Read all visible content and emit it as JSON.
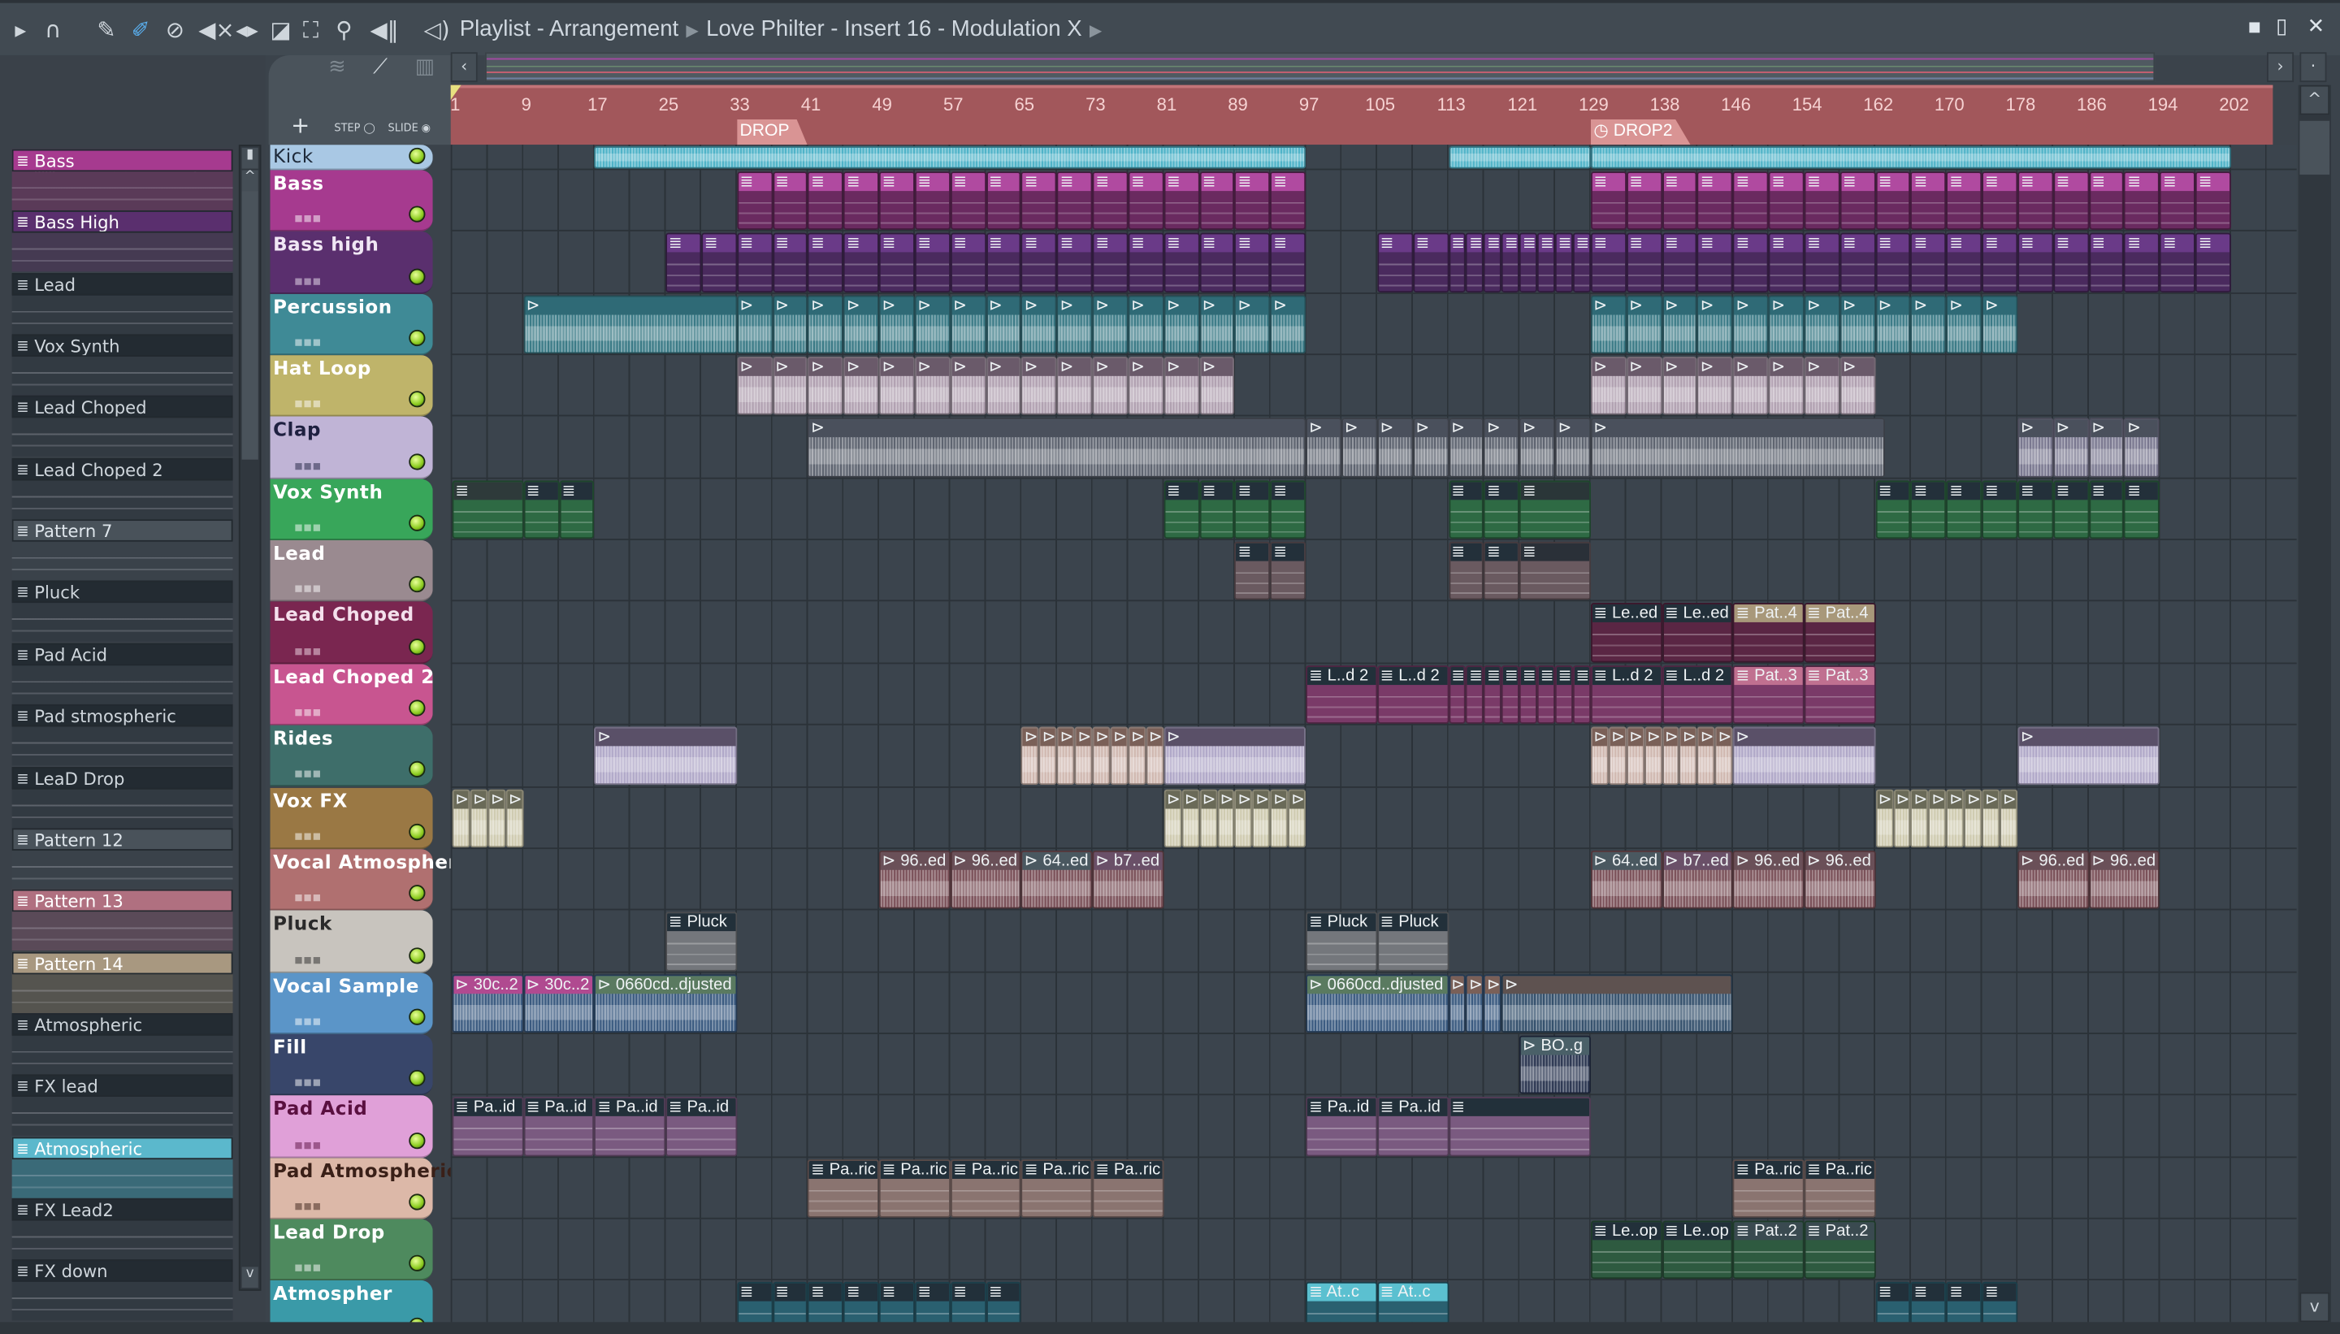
{
  "titlebar": {
    "crumbs": [
      "Playlist - Arrangement",
      "Love Philter - Insert 16 - Modulation X"
    ],
    "icons": [
      "play-arrow-icon",
      "magnet-icon",
      "pencil-icon",
      "paint-brush-icon",
      "mute-icon",
      "speaker-mute-icon",
      "slip-icon",
      "slice-icon",
      "select-icon",
      "zoom-icon",
      "playback-icon"
    ],
    "window_buttons": [
      "minimize",
      "maximize",
      "close"
    ]
  },
  "toolbar": {
    "add_label": "+",
    "step_label": "STEP",
    "slide_label": "SLIDE"
  },
  "picker": {
    "items": [
      {
        "name": "Bass",
        "color": "#a63a8f",
        "text": "#ffffff",
        "body": "#5a3a58"
      },
      {
        "name": "Bass High",
        "color": "#5a2f6e",
        "text": "#ffffff",
        "body": "#453a52"
      },
      {
        "name": "Lead",
        "color": "#232b32",
        "text": "#cfd6dc",
        "body": "#323a42"
      },
      {
        "name": "Vox Synth",
        "color": "#232b32",
        "text": "#cfd6dc",
        "body": "#323a42"
      },
      {
        "name": "Lead Choped",
        "color": "#232b32",
        "text": "#cfd6dc",
        "body": "#323a42"
      },
      {
        "name": "Lead Choped 2",
        "color": "#232b32",
        "text": "#cfd6dc",
        "body": "#323a42"
      },
      {
        "name": "Pattern 7",
        "color": "#49525a",
        "text": "#dfe6ec",
        "body": "#3a424a"
      },
      {
        "name": "Pluck",
        "color": "#232b32",
        "text": "#cfd6dc",
        "body": "#323a42"
      },
      {
        "name": "Pad Acid",
        "color": "#232b32",
        "text": "#cfd6dc",
        "body": "#323a42"
      },
      {
        "name": "Pad stmospheric",
        "color": "#232b32",
        "text": "#cfd6dc",
        "body": "#323a42"
      },
      {
        "name": "LeaD Drop",
        "color": "#232b32",
        "text": "#cfd6dc",
        "body": "#323a42"
      },
      {
        "name": "Pattern 12",
        "color": "#49525a",
        "text": "#dfe6ec",
        "body": "#3a424a"
      },
      {
        "name": "Pattern 13",
        "color": "#b07080",
        "text": "#ffffff",
        "body": "#5a4a58"
      },
      {
        "name": "Pattern 14",
        "color": "#a89880",
        "text": "#ffffff",
        "body": "#55544f"
      },
      {
        "name": "Atmospheric",
        "color": "#232b32",
        "text": "#cfd6dc",
        "body": "#323a42"
      },
      {
        "name": "FX lead",
        "color": "#232b32",
        "text": "#cfd6dc",
        "body": "#323a42"
      },
      {
        "name": "Atmospheric",
        "color": "#5bb8cc",
        "text": "#ffffff",
        "body": "#3a6a78"
      },
      {
        "name": "FX Lead2",
        "color": "#232b32",
        "text": "#cfd6dc",
        "body": "#323a42"
      },
      {
        "name": "FX down",
        "color": "#232b32",
        "text": "#cfd6dc",
        "body": "#323a42"
      }
    ]
  },
  "ruler": {
    "ticks": [
      "1",
      "9",
      "17",
      "25",
      "33",
      "41",
      "49",
      "57",
      "65",
      "73",
      "81",
      "89",
      "97",
      "105",
      "113",
      "121",
      "129",
      "138",
      "146",
      "154",
      "162",
      "170",
      "178",
      "186",
      "194",
      "202"
    ],
    "markers": [
      {
        "label": "DROP",
        "bar": 33,
        "icon": ""
      },
      {
        "label": "DROP2",
        "bar": 129,
        "icon": "clock-icon"
      }
    ]
  },
  "tracks": [
    {
      "name": "Kick",
      "color": "#a9c8e4",
      "text": "#1e2a3a"
    },
    {
      "name": "Bass",
      "color": "#a63a8f",
      "text": "#ffffff"
    },
    {
      "name": "Bass high",
      "color": "#5a2f6e",
      "text": "#f0e6f4"
    },
    {
      "name": "Percussion",
      "color": "#3f8a96",
      "text": "#ffffff"
    },
    {
      "name": "Hat Loop",
      "color": "#bfb46a",
      "text": "#ffffff"
    },
    {
      "name": "Clap",
      "color": "#c0b4d6",
      "text": "#1e2040"
    },
    {
      "name": "Vox Synth",
      "color": "#38a65a",
      "text": "#ffffff"
    },
    {
      "name": "Lead",
      "color": "#9a8a90",
      "text": "#ffffff"
    },
    {
      "name": "Lead Choped",
      "color": "#7a2650",
      "text": "#f4e0ec"
    },
    {
      "name": "Lead Choped 2",
      "color": "#c85590",
      "text": "#ffffff"
    },
    {
      "name": "Rides",
      "color": "#3e6e6a",
      "text": "#ffffff"
    },
    {
      "name": "Vox FX",
      "color": "#9a7844",
      "text": "#ffffff"
    },
    {
      "name": "Vocal Atmospheric",
      "color": "#b07070",
      "text": "#ffffff"
    },
    {
      "name": "Pluck",
      "color": "#c8c4be",
      "text": "#2a2a2a"
    },
    {
      "name": "Vocal Sample",
      "color": "#5b95c8",
      "text": "#ffffff"
    },
    {
      "name": "Fill",
      "color": "#38466a",
      "text": "#ffffff"
    },
    {
      "name": "Pad Acid",
      "color": "#e0a0d8",
      "text": "#5a1040"
    },
    {
      "name": "Pad Atmospheric",
      "color": "#dcb8a8",
      "text": "#3a2018"
    },
    {
      "name": "Lead Drop",
      "color": "#4e8a5e",
      "text": "#ffffff"
    },
    {
      "name": "Atmospher",
      "color": "#3a9aa8",
      "text": "#ffffff"
    }
  ],
  "clips": [
    {
      "t": 0,
      "s": 17,
      "n": 1,
      "l": 80,
      "type": "a",
      "label": "",
      "c": "#4fb3c8",
      "b": "#4fb3c8"
    },
    {
      "t": 0,
      "s": 113,
      "n": 1,
      "l": 16,
      "type": "a",
      "label": "",
      "c": "#4fb3c8",
      "b": "#4fb3c8"
    },
    {
      "t": 0,
      "s": 129,
      "n": 1,
      "l": 72,
      "type": "a",
      "label": "",
      "c": "#4fb3c8",
      "b": "#4fb3c8"
    },
    {
      "t": 1,
      "s": 33,
      "n": 16,
      "l": 4,
      "type": "p",
      "label": "",
      "c": "#b04aa0",
      "b": "#6a2a60"
    },
    {
      "t": 1,
      "s": 129,
      "n": 18,
      "l": 4,
      "type": "p",
      "label": "",
      "c": "#b04aa0",
      "b": "#6a2a60"
    },
    {
      "t": 2,
      "s": 25,
      "n": 18,
      "l": 4,
      "type": "p",
      "label": "",
      "c": "#6a3a88",
      "b": "#4a2a5e"
    },
    {
      "t": 2,
      "s": 105,
      "n": 2,
      "l": 4,
      "type": "p",
      "label": "",
      "c": "#6a3a88",
      "b": "#4a2a5e"
    },
    {
      "t": 2,
      "s": 113,
      "n": 8,
      "l": 2,
      "type": "p",
      "label": "",
      "c": "#6a3a88",
      "b": "#4a2a5e"
    },
    {
      "t": 2,
      "s": 129,
      "n": 18,
      "l": 4,
      "type": "p",
      "label": "",
      "c": "#6a3a88",
      "b": "#4a2a5e"
    },
    {
      "t": 3,
      "s": 9,
      "n": 1,
      "l": 24,
      "type": "a",
      "label": "",
      "c": "#2f6a76",
      "b": "#3a7a86"
    },
    {
      "t": 3,
      "s": 33,
      "n": 16,
      "l": 4,
      "type": "a",
      "label": "",
      "c": "#2f6a76",
      "b": "#3a7a86"
    },
    {
      "t": 3,
      "s": 129,
      "n": 12,
      "l": 4,
      "type": "a",
      "label": "",
      "c": "#2f6a76",
      "b": "#3a7a86"
    },
    {
      "t": 4,
      "s": 33,
      "n": 12,
      "l": 4,
      "type": "a",
      "label": "",
      "c": "#6a5a6a",
      "b": "#b0a0b0"
    },
    {
      "t": 4,
      "s": 81,
      "n": 2,
      "l": 4,
      "type": "a",
      "label": "",
      "c": "#6a5a6a",
      "b": "#b0a0b0"
    },
    {
      "t": 4,
      "s": 129,
      "n": 8,
      "l": 4,
      "type": "a",
      "label": "",
      "c": "#6a5a6a",
      "b": "#b0a0b0"
    },
    {
      "t": 5,
      "s": 41,
      "n": 1,
      "l": 56,
      "type": "a",
      "label": "",
      "c": "#4a505c",
      "b": "#5e6470"
    },
    {
      "t": 5,
      "s": 97,
      "n": 8,
      "l": 4,
      "type": "a",
      "label": "",
      "c": "#4a505c",
      "b": "#5e6470"
    },
    {
      "t": 5,
      "s": 129,
      "n": 1,
      "l": 33,
      "type": "a",
      "label": "",
      "c": "#4a505c",
      "b": "#5e6470"
    },
    {
      "t": 5,
      "s": 177,
      "n": 4,
      "l": 4,
      "type": "a",
      "label": "",
      "c": "#4a505c",
      "b": "#7a7890"
    },
    {
      "t": 6,
      "s": 1,
      "n": 1,
      "l": 8,
      "type": "p",
      "label": "",
      "c": "#2e3a3a",
      "b": "#2e6a44"
    },
    {
      "t": 6,
      "s": 9,
      "n": 2,
      "l": 4,
      "type": "p",
      "label": "",
      "c": "#23303a",
      "b": "#2e6a44"
    },
    {
      "t": 6,
      "s": 81,
      "n": 4,
      "l": 4,
      "type": "p",
      "label": "",
      "c": "#23303a",
      "b": "#2e6a44"
    },
    {
      "t": 6,
      "s": 113,
      "n": 2,
      "l": 4,
      "type": "p",
      "label": "",
      "c": "#23303a",
      "b": "#2e6a44"
    },
    {
      "t": 6,
      "s": 121,
      "n": 1,
      "l": 8,
      "type": "p",
      "label": "",
      "c": "#2a3638",
      "b": "#2e6a44"
    },
    {
      "t": 6,
      "s": 161,
      "n": 8,
      "l": 4,
      "type": "p",
      "label": "",
      "c": "#23303a",
      "b": "#2e6a44"
    },
    {
      "t": 7,
      "s": 89,
      "n": 2,
      "l": 4,
      "type": "p",
      "label": "",
      "c": "#23303a",
      "b": "#6a5a60"
    },
    {
      "t": 7,
      "s": 113,
      "n": 2,
      "l": 4,
      "type": "p",
      "label": "",
      "c": "#23303a",
      "b": "#6a5a60"
    },
    {
      "t": 7,
      "s": 121,
      "n": 1,
      "l": 8,
      "type": "p",
      "label": "",
      "c": "#2a3038",
      "b": "#6a5a60"
    },
    {
      "t": 8,
      "s": 129,
      "n": 2,
      "l": 8,
      "type": "p",
      "label": "Le..ed",
      "c": "#22303a",
      "b": "#5a2644"
    },
    {
      "t": 8,
      "s": 145,
      "n": 2,
      "l": 8,
      "type": "p",
      "label": "Pat..4",
      "c": "#a8987a",
      "b": "#5a2644"
    },
    {
      "t": 9,
      "s": 97,
      "n": 2,
      "l": 8,
      "type": "p",
      "label": "L..d 2",
      "c": "#22303a",
      "b": "#7a3a68"
    },
    {
      "t": 9,
      "s": 113,
      "n": 8,
      "l": 2,
      "type": "p",
      "label": "",
      "c": "#22303a",
      "b": "#7a3a68"
    },
    {
      "t": 9,
      "s": 129,
      "n": 2,
      "l": 8,
      "type": "p",
      "label": "L..d 2",
      "c": "#22303a",
      "b": "#7a3a68"
    },
    {
      "t": 9,
      "s": 145,
      "n": 2,
      "l": 8,
      "type": "p",
      "label": "Pat..3",
      "c": "#c07090",
      "b": "#7a3a68"
    },
    {
      "t": 10,
      "s": 17,
      "n": 1,
      "l": 16,
      "type": "a",
      "label": "",
      "c": "#5a5068",
      "b": "#b0a8c8"
    },
    {
      "t": 10,
      "s": 65,
      "n": 8,
      "l": 2,
      "type": "a",
      "label": "",
      "c": "#7a6058",
      "b": "#d0b8b0"
    },
    {
      "t": 10,
      "s": 81,
      "n": 1,
      "l": 16,
      "type": "a",
      "label": "",
      "c": "#5a5068",
      "b": "#b0a8c8"
    },
    {
      "t": 10,
      "s": 129,
      "n": 8,
      "l": 2,
      "type": "a",
      "label": "",
      "c": "#7a6058",
      "b": "#d0b8b0"
    },
    {
      "t": 10,
      "s": 145,
      "n": 1,
      "l": 16,
      "type": "a",
      "label": "",
      "c": "#5a5068",
      "b": "#b0a8c8"
    },
    {
      "t": 10,
      "s": 177,
      "n": 1,
      "l": 16,
      "type": "a",
      "label": "",
      "c": "#5a5068",
      "b": "#b0a8c8"
    },
    {
      "t": 11,
      "s": 1,
      "n": 4,
      "l": 2,
      "type": "a",
      "label": "",
      "c": "#6a6a58",
      "b": "#cfcbb0"
    },
    {
      "t": 11,
      "s": 81,
      "n": 8,
      "l": 2,
      "type": "a",
      "label": "",
      "c": "#6a6a58",
      "b": "#cfcbb0"
    },
    {
      "t": 11,
      "s": 161,
      "n": 8,
      "l": 2,
      "type": "a",
      "label": "",
      "c": "#6a6a58",
      "b": "#cfcbb0"
    },
    {
      "t": 12,
      "s": 49,
      "n": 2,
      "l": 8,
      "type": "a",
      "label": "96..ed",
      "c": "#6a5058",
      "b": "#7a5058"
    },
    {
      "t": 12,
      "s": 65,
      "n": 1,
      "l": 8,
      "type": "a",
      "label": "64..ed",
      "c": "#4a5860",
      "b": "#7a5058"
    },
    {
      "t": 12,
      "s": 73,
      "n": 1,
      "l": 8,
      "type": "a",
      "label": "b7..ed",
      "c": "#6a5068",
      "b": "#7a5058"
    },
    {
      "t": 12,
      "s": 129,
      "n": 1,
      "l": 8,
      "type": "a",
      "label": "64..ed",
      "c": "#4a5860",
      "b": "#7a5058"
    },
    {
      "t": 12,
      "s": 137,
      "n": 1,
      "l": 8,
      "type": "a",
      "label": "b7..ed",
      "c": "#6a5068",
      "b": "#7a5058"
    },
    {
      "t": 12,
      "s": 145,
      "n": 2,
      "l": 8,
      "type": "a",
      "label": "96..ed",
      "c": "#6a5058",
      "b": "#7a5058"
    },
    {
      "t": 12,
      "s": 177,
      "n": 2,
      "l": 8,
      "type": "a",
      "label": "96..ed",
      "c": "#6a5058",
      "b": "#7a5058"
    },
    {
      "t": 13,
      "s": 25,
      "n": 1,
      "l": 8,
      "type": "p",
      "label": "Pluck",
      "c": "#22303a",
      "b": "#74777c"
    },
    {
      "t": 13,
      "s": 97,
      "n": 2,
      "l": 8,
      "type": "p",
      "label": "Pluck",
      "c": "#22303a",
      "b": "#74777c"
    },
    {
      "t": 14,
      "s": 1,
      "n": 2,
      "l": 8,
      "type": "a",
      "label": "30c..2",
      "c": "#b04a90",
      "b": "#3a5a80"
    },
    {
      "t": 14,
      "s": 17,
      "n": 1,
      "l": 16,
      "type": "a",
      "label": "0660cd..djusted",
      "c": "#5a7a60",
      "b": "#3a5a80"
    },
    {
      "t": 14,
      "s": 97,
      "n": 1,
      "l": 16,
      "type": "a",
      "label": "0660cd..djusted",
      "c": "#5a7a60",
      "b": "#3a5a80"
    },
    {
      "t": 14,
      "s": 113,
      "n": 3,
      "l": 2,
      "type": "a",
      "label": "",
      "c": "#7a6058",
      "b": "#3a5a80"
    },
    {
      "t": 14,
      "s": 119,
      "n": 1,
      "l": 26,
      "type": "a",
      "label": "",
      "c": "#5e5250",
      "b": "#34506c"
    },
    {
      "t": 15,
      "s": 121,
      "n": 1,
      "l": 8,
      "type": "a",
      "label": "BO..g",
      "c": "#4a6068",
      "b": "#2a3550"
    },
    {
      "t": 16,
      "s": 1,
      "n": 4,
      "l": 8,
      "type": "p",
      "label": "Pa..id",
      "c": "#22303a",
      "b": "#7a5a80"
    },
    {
      "t": 16,
      "s": 97,
      "n": 2,
      "l": 8,
      "type": "p",
      "label": "Pa..id",
      "c": "#22303a",
      "b": "#7a5a80"
    },
    {
      "t": 16,
      "s": 113,
      "n": 1,
      "l": 16,
      "type": "p",
      "label": "",
      "c": "#22303a",
      "b": "#7a5a80"
    },
    {
      "t": 17,
      "s": 41,
      "n": 5,
      "l": 8,
      "type": "p",
      "label": "Pa..ric",
      "c": "#22303a",
      "b": "#8a7470"
    },
    {
      "t": 17,
      "s": 145,
      "n": 2,
      "l": 8,
      "type": "p",
      "label": "Pa..ric",
      "c": "#22303a",
      "b": "#8a7470"
    },
    {
      "t": 18,
      "s": 129,
      "n": 2,
      "l": 8,
      "type": "p",
      "label": "Le..op",
      "c": "#22303a",
      "b": "#2e5a40"
    },
    {
      "t": 18,
      "s": 145,
      "n": 2,
      "l": 8,
      "type": "p",
      "label": "Pat..2",
      "c": "#3a4a50",
      "b": "#2e5a40"
    },
    {
      "t": 19,
      "s": 33,
      "n": 8,
      "l": 4,
      "type": "p",
      "label": "",
      "c": "#22303a",
      "b": "#2a6070"
    },
    {
      "t": 19,
      "s": 97,
      "n": 2,
      "l": 8,
      "type": "p",
      "label": "At..c",
      "c": "#5bc0d0",
      "b": "#2a6070"
    },
    {
      "t": 19,
      "s": 161,
      "n": 4,
      "l": 4,
      "type": "p",
      "label": "",
      "c": "#22303a",
      "b": "#2a6070"
    }
  ]
}
